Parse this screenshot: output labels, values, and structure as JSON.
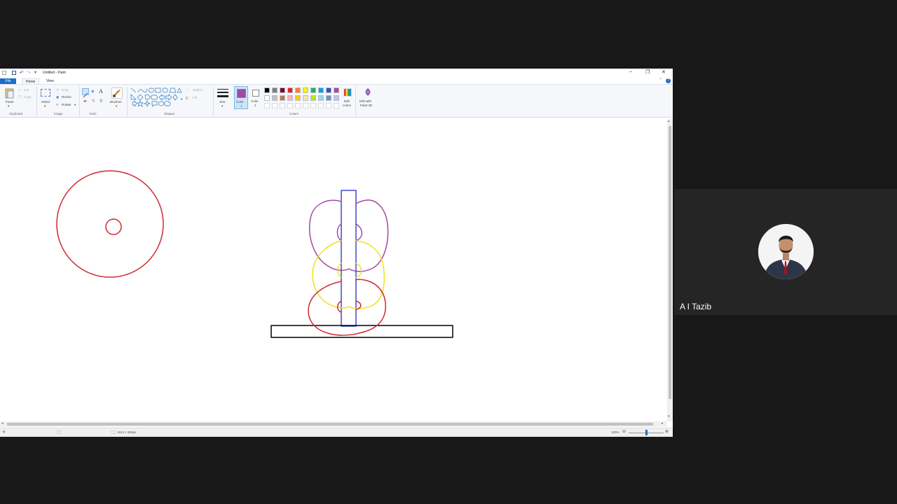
{
  "window": {
    "title": "Untitled - Paint"
  },
  "tabs": {
    "file": "File",
    "home": "Home",
    "view": "View"
  },
  "ribbon": {
    "clipboard": {
      "paste": "Paste",
      "cut": "Cut",
      "copy": "Copy",
      "label": "Clipboard"
    },
    "image": {
      "select": "Select",
      "crop": "Crop",
      "resize": "Resize",
      "rotate": "Rotate",
      "label": "Image"
    },
    "tools": {
      "label": "Tools"
    },
    "brushes": {
      "label": "Brushes"
    },
    "shapes": {
      "outline": "Outline",
      "fill": "Fill",
      "label": "Shapes"
    },
    "size": {
      "label": "Size"
    },
    "colors": {
      "color1_line1": "Color",
      "color1_line2": "1",
      "color2_line1": "Color",
      "color2_line2": "2",
      "edit_colors_line1": "Edit",
      "edit_colors_line2": "colors",
      "label": "Colors",
      "color1_value": "#a349a4",
      "color2_value": "#ffffff",
      "palette_row1": [
        "#000000",
        "#7f7f7f",
        "#880015",
        "#ed1c24",
        "#ff7f27",
        "#fff200",
        "#22b14c",
        "#00a2e8",
        "#3f48cc",
        "#a349a4"
      ],
      "palette_row2": [
        "#ffffff",
        "#c3c3c3",
        "#b97a57",
        "#ffaec9",
        "#ffc90e",
        "#efe4b0",
        "#b5e61d",
        "#99d9ea",
        "#7092be",
        "#c8bfe7"
      ]
    },
    "paint3d": {
      "line1": "Edit with",
      "line2": "Paint 3D"
    }
  },
  "status": {
    "dimensions": "1914 × 905px",
    "zoom": "100%"
  },
  "participant": {
    "name": "A I Tazib"
  }
}
